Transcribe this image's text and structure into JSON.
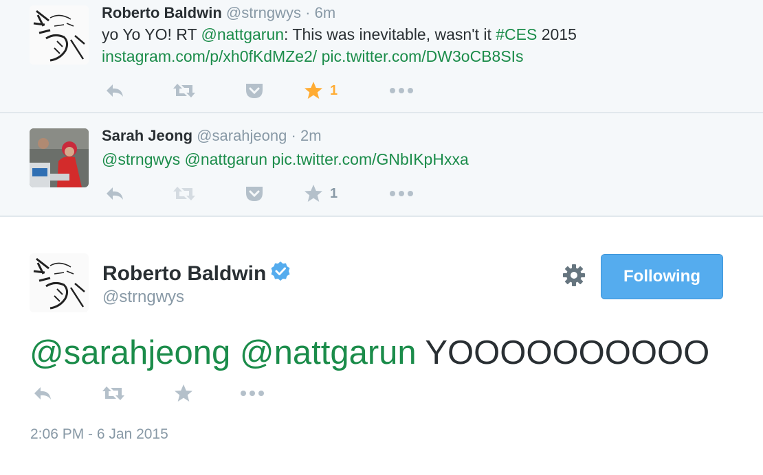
{
  "tweets": [
    {
      "name": "Roberto Baldwin",
      "handle": "@strngwys",
      "sep": "·",
      "time": "6m",
      "text_prefix": "yo Yo YO! RT ",
      "mention": "@nattgarun",
      "text_middle": ": This was inevitable, wasn't it ",
      "hashtag": "#CES",
      "text_suffix": " 2015",
      "link1": "instagram.com/p/xh0fKdMZe2/",
      "link2": "pic.twitter.com/DW3oCB8SIs",
      "favorite_count": "1",
      "favorited": true,
      "avatar": "sketch-face-avatar"
    },
    {
      "name": "Sarah Jeong",
      "handle": "@sarahjeong",
      "sep": "·",
      "time": "2m",
      "mention1": "@strngwys",
      "mention2": "@nattgarun",
      "link": "pic.twitter.com/GNbIKpHxxa",
      "favorite_count": "1",
      "favorited": false,
      "avatar": "red-jacket-photo-avatar"
    }
  ],
  "main": {
    "name": "Roberto Baldwin",
    "handle": "@strngwys",
    "verified": true,
    "follow_label": "Following",
    "mention1": "@sarahjeong",
    "mention2": "@nattgarun",
    "text": "YOOOOOOOOOO",
    "timestamp": "2:06 PM - 6 Jan 2015"
  },
  "colors": {
    "link": "#1b8c4a",
    "muted": "#8899a6",
    "favorite": "#ffac33",
    "button": "#55acee",
    "verified": "#55acee",
    "background_stream": "#f5f8fa"
  },
  "icons": [
    "reply-icon",
    "retweet-icon",
    "pocket-icon",
    "star-icon",
    "more-icon",
    "gear-icon",
    "verified-icon"
  ]
}
